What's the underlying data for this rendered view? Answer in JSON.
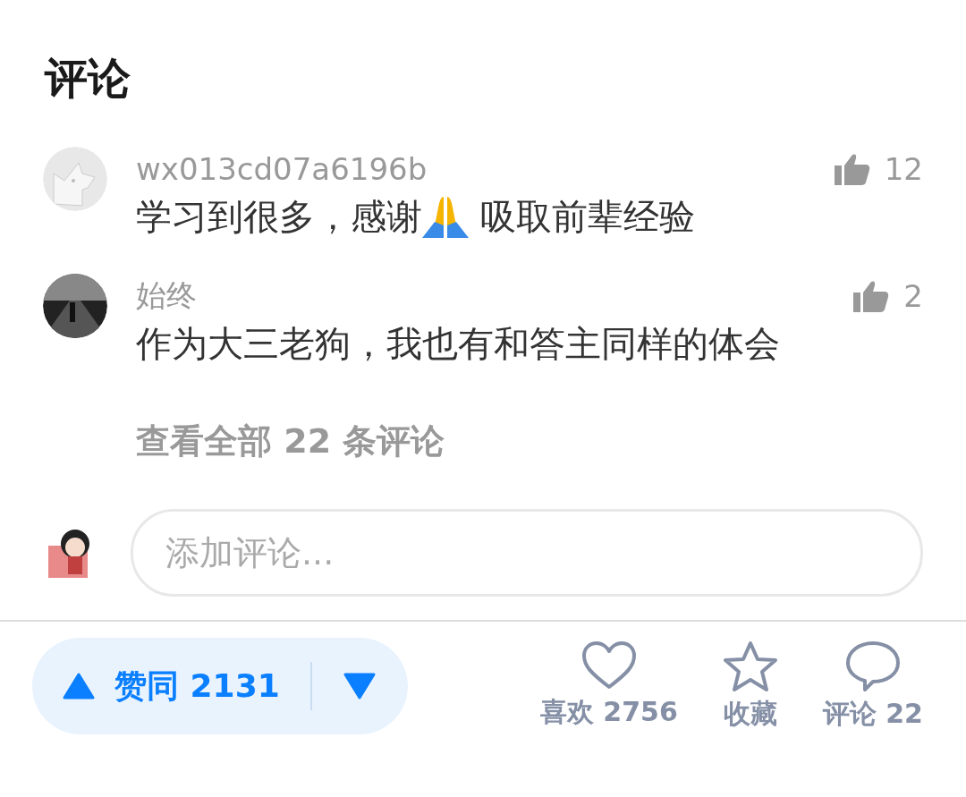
{
  "section_title": "评论",
  "comments": [
    {
      "username": "wx013cd07a6196b",
      "likes": "12",
      "parts": [
        {
          "kind": "text",
          "text": "学习到很多，感谢"
        },
        {
          "kind": "emoji"
        },
        {
          "kind": "text",
          "text": " 吸取前辈经验"
        }
      ]
    },
    {
      "username": "始终",
      "likes": "2",
      "parts": [
        {
          "kind": "text",
          "text": "作为大三老狗，我也有和答主同样的体会"
        }
      ]
    }
  ],
  "view_all": "查看全部 22 条评论",
  "comment_input": {
    "placeholder": "添加评论..."
  },
  "bottom_bar": {
    "vote": {
      "label": "赞同 2131"
    },
    "actions": [
      {
        "kind": "heart",
        "label": "喜欢 2756"
      },
      {
        "kind": "star",
        "label": "收藏"
      },
      {
        "kind": "chat",
        "label": "评论 22"
      }
    ]
  }
}
